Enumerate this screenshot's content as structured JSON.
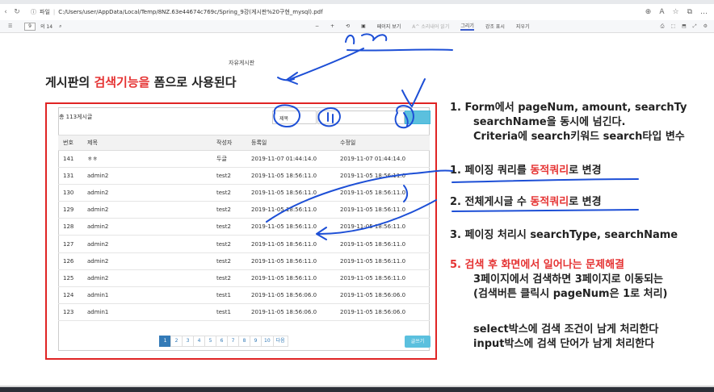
{
  "browser": {
    "info_icon": "info-icon",
    "file_label": "파일",
    "url": "C:/Users/user/AppData/Local/Temp/8NZ.63e44674c769c/Spring_9강(게시판%20구현_mysql).pdf"
  },
  "pdf_toolbar": {
    "page_current": "9",
    "page_total": "의 14",
    "page_view": "페이지 보기",
    "read_aloud": "A^ 소리내어 읽기",
    "draw": "그리기",
    "highlight": "강조 표시",
    "erase": "지우기"
  },
  "document": {
    "subtitle": "자유게시판",
    "headline": {
      "part1": "게시판의 ",
      "part2": "검색기능을",
      "part3": " 폼으로 사용된다"
    },
    "board": {
      "count": "총 113게시글",
      "select_value": "제목",
      "columns": [
        "번호",
        "제목",
        "작성자",
        "등록일",
        "수정일"
      ],
      "rows": [
        [
          "141",
          "ㅎㅎ",
          "두글",
          "2019-11-07 01:44:14.0",
          "2019-11-07 01:44:14.0"
        ],
        [
          "131",
          "admin2",
          "test2",
          "2019-11-05 18:56:11.0",
          "2019-11-05 18:56:11.0"
        ],
        [
          "130",
          "admin2",
          "test2",
          "2019-11-05 18:56:11.0",
          "2019-11-05 18:56:11.0"
        ],
        [
          "129",
          "admin2",
          "test2",
          "2019-11-05 18:56:11.0",
          "2019-11-05 18:56:11.0"
        ],
        [
          "128",
          "admin2",
          "test2",
          "2019-11-05 18:56:11.0",
          "2019-11-05 18:56:11.0"
        ],
        [
          "127",
          "admin2",
          "test2",
          "2019-11-05 18:56:11.0",
          "2019-11-05 18:56:11.0"
        ],
        [
          "126",
          "admin2",
          "test2",
          "2019-11-05 18:56:11.0",
          "2019-11-05 18:56:11.0"
        ],
        [
          "125",
          "admin2",
          "test2",
          "2019-11-05 18:56:11.0",
          "2019-11-05 18:56:11.0"
        ],
        [
          "124",
          "admin1",
          "test1",
          "2019-11-05 18:56:06.0",
          "2019-11-05 18:56:06.0"
        ],
        [
          "123",
          "admin1",
          "test1",
          "2019-11-05 18:56:06.0",
          "2019-11-05 18:56:06.0"
        ]
      ],
      "pages": [
        "1",
        "2",
        "3",
        "4",
        "5",
        "6",
        "7",
        "8",
        "9",
        "10",
        "다음"
      ],
      "write_button": "글쓰기"
    },
    "notes": {
      "n1_line1": "1.  Form에서 pageNum, amount, searchTy",
      "n1_line2": "searchName을 동시에 넘긴다.",
      "n1_line3": "Criteria에 search키워드 search타입 변수",
      "n2_a": "1.  페이징 쿼리를 ",
      "n2_b": "동적쿼리",
      "n2_c": "로 변경",
      "n3_a": "2.  전체게시글 수 ",
      "n3_b": "동적쿼리",
      "n3_c": "로 변경",
      "n4": "3.  페이징 처리시 searchType, searchName",
      "n5_title": "5.  검색 후 화면에서 일어나는 문제해결",
      "n5_line1": "3페이지에서 검색하면 3페이지로 이동되는",
      "n5_line2": "(검색버튼 클릭시 pageNum은 1로 처리)",
      "n5_line3": "select박스에 검색 조건이 남게 처리한다",
      "n5_line4": "input박스에 검색 단어가 남게 처리한다"
    }
  },
  "colors": {
    "accent_red": "#e53333",
    "box_red": "#e02424",
    "ink_blue": "#1d4fd6",
    "pager_blue": "#337ab7",
    "button_cyan": "#5bc0de"
  }
}
